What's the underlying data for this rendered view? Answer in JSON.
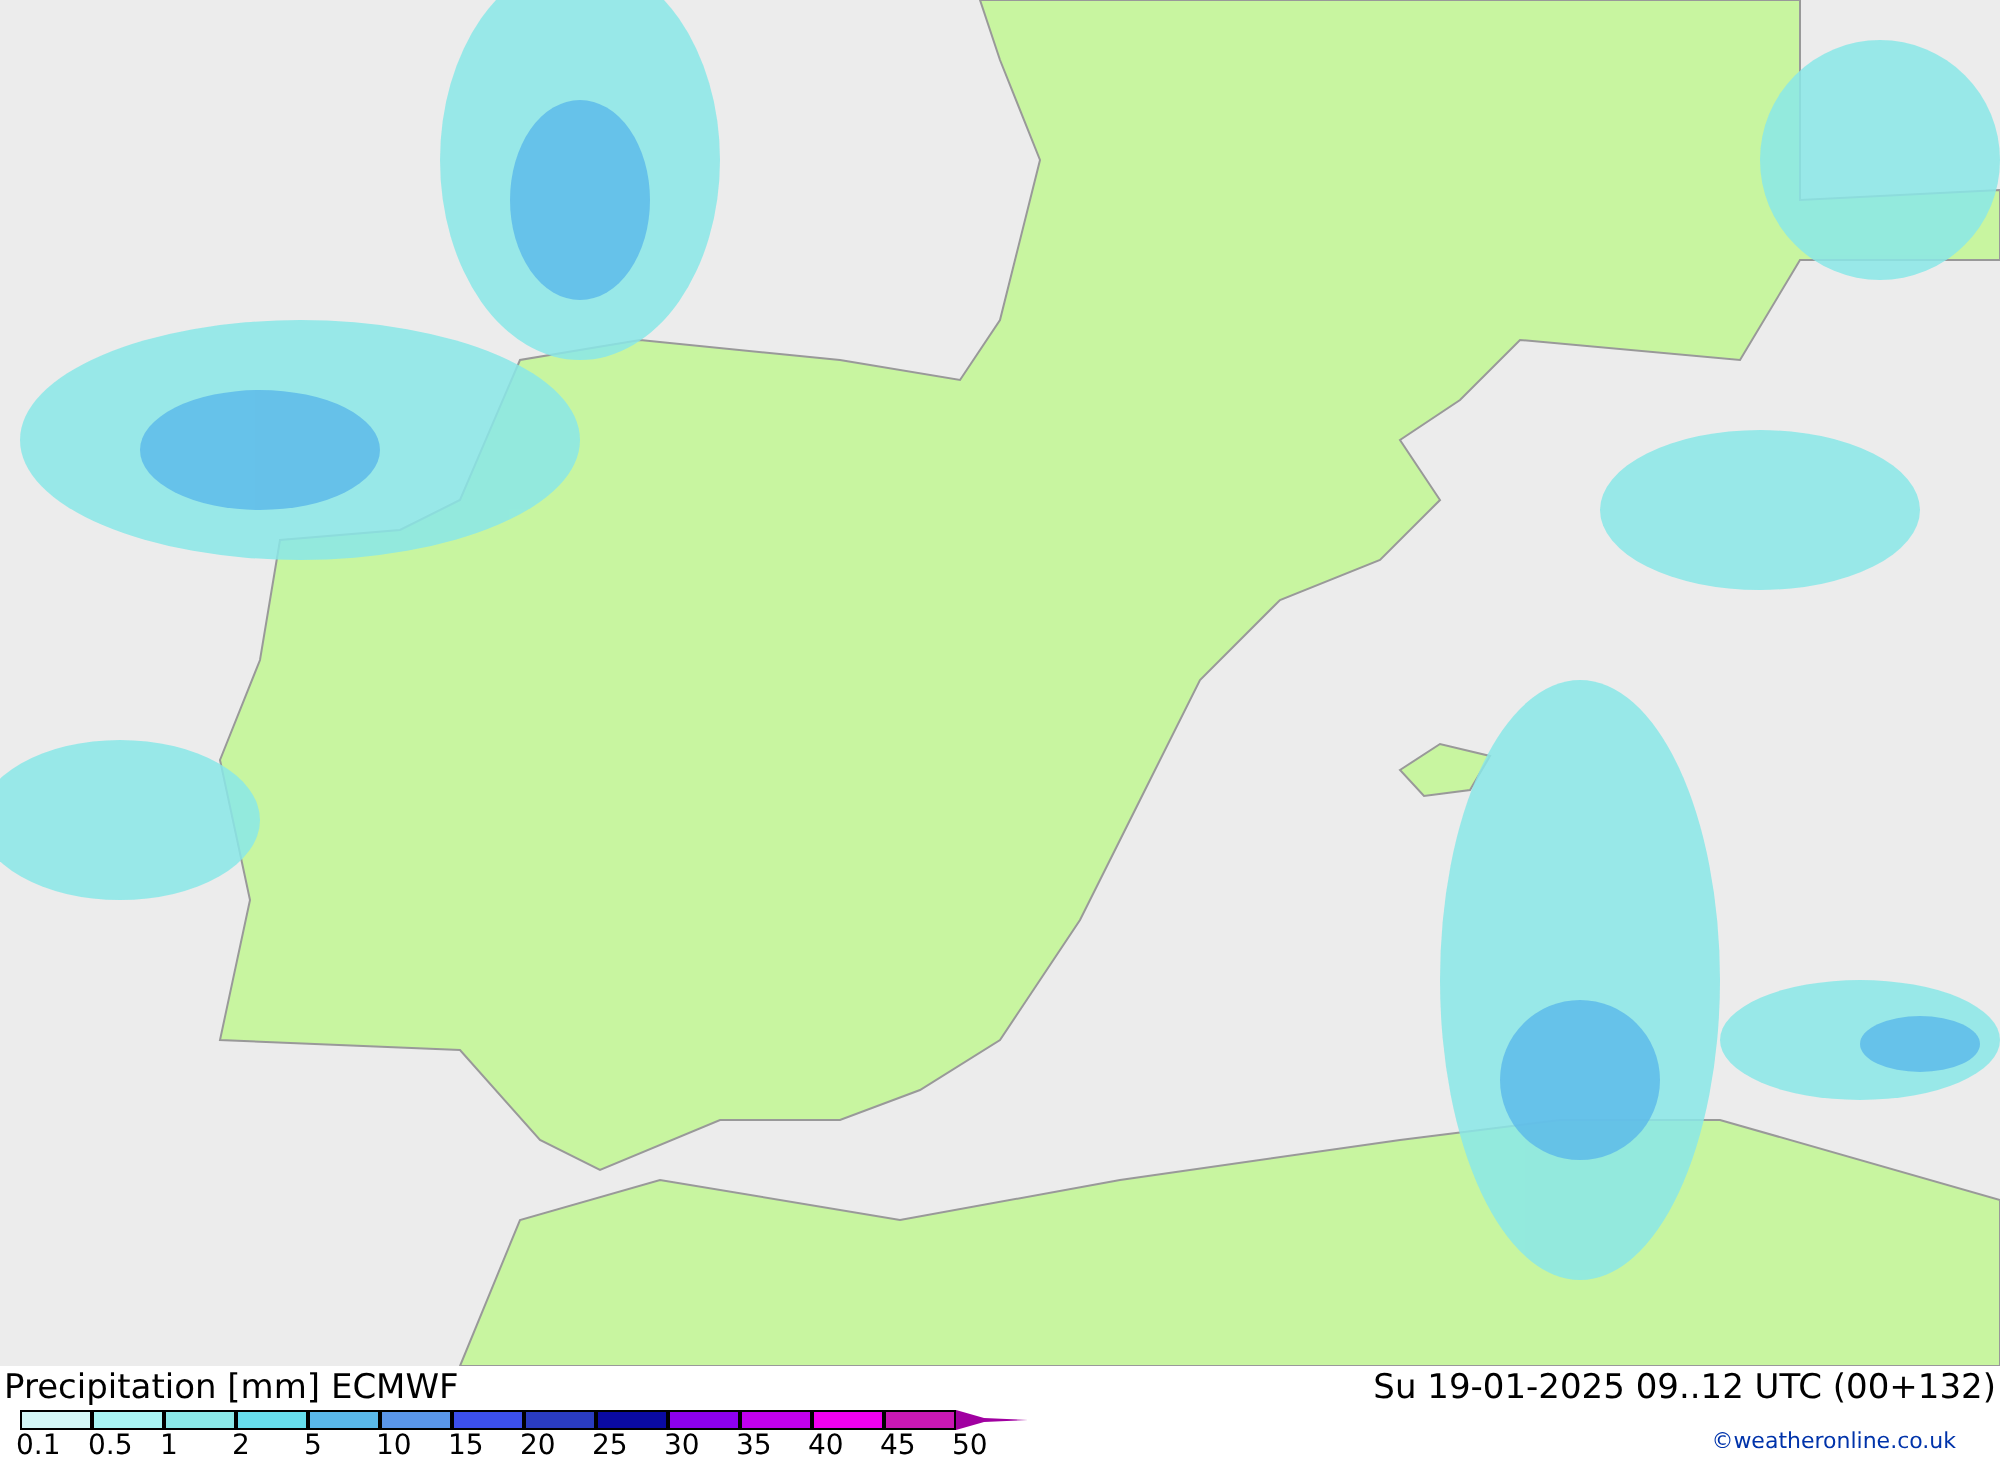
{
  "title": "Precipitation [mm] ECMWF",
  "legend": [
    {
      "label": "0.1",
      "color": "#d4f7f7"
    },
    {
      "label": "0.5",
      "color": "#a8f5f5"
    },
    {
      "label": "1",
      "color": "#8ae8e8"
    },
    {
      "label": "2",
      "color": "#66dcec"
    },
    {
      "label": "5",
      "color": "#5ab8ea"
    },
    {
      "label": "10",
      "color": "#5a96ea"
    },
    {
      "label": "15",
      "color": "#3c50ec"
    },
    {
      "label": "20",
      "color": "#2a3cc0"
    },
    {
      "label": "25",
      "color": "#0a0aa0"
    },
    {
      "label": "30",
      "color": "#8c00ee"
    },
    {
      "label": "35",
      "color": "#c000ee"
    },
    {
      "label": "40",
      "color": "#f000f0"
    },
    {
      "label": "45",
      "color": "#c818b4"
    },
    {
      "label": "50",
      "color": "#a000a0"
    }
  ],
  "valid_time": "Su 19-01-2025 09..12 UTC (00+132)",
  "credit": "©weatheronline.co.uk"
}
